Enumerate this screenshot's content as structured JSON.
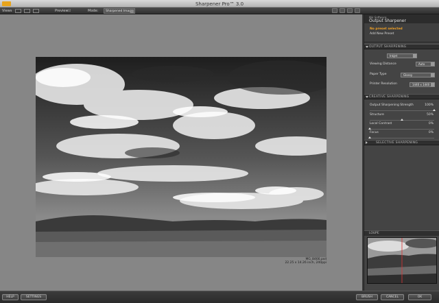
{
  "window": {
    "title": "Sharpener Pro™ 3.0"
  },
  "toolbar": {
    "views_label": "Views",
    "preview_label": "Preview",
    "mode_label": "Mode:",
    "mode_value": "Sharpened Image"
  },
  "photo": {
    "filename": "MG_8466.psd",
    "dimensions": "22.25 x 14.26 inch, 240ppi"
  },
  "panel": {
    "brand": "Nik Software",
    "title": "Output Sharpener",
    "preset_status": "No preset selected",
    "add_preset": "Add New Preset",
    "sections": {
      "output": "OUTPUT SHARPENING",
      "creative": "CREATIVE SHARPENING",
      "selective": "SELECTIVE SHARPENING",
      "loupe": "LOUPE"
    },
    "output_type": "Inkjet",
    "viewing_distance": {
      "label": "Viewing Distance",
      "value": "Auto"
    },
    "paper_type": {
      "label": "Paper Type",
      "value": "Glossy"
    },
    "printer_resolution": {
      "label": "Printer Resolution",
      "value": "1440 x 1440"
    },
    "creative_sliders": [
      {
        "label": "Output Sharpening Strength",
        "value": "100%",
        "level": 1.0
      },
      {
        "label": "Structure",
        "value": "50%",
        "level": 0.5
      },
      {
        "label": "Local Contrast",
        "value": "0%",
        "level": 0.0
      },
      {
        "label": "Focus",
        "value": "0%",
        "level": 0.0
      }
    ]
  },
  "buttons": {
    "help": "HELP",
    "settings": "SETTINGS",
    "brush": "BRUSH",
    "cancel": "CANCEL",
    "ok": "OK"
  },
  "colors": {
    "warning": "#f2a227",
    "canvas": "#868686",
    "panel": "#444444"
  }
}
